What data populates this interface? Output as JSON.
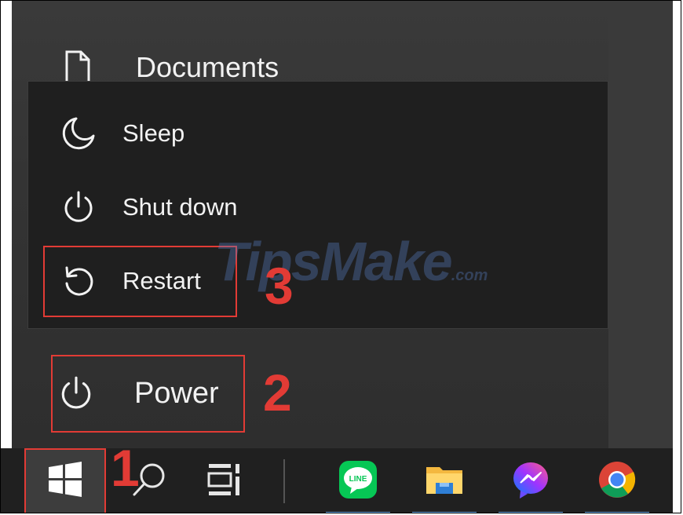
{
  "start_menu": {
    "documents_label": "Documents",
    "power_label": "Power"
  },
  "power_menu": {
    "items": [
      {
        "label": "Sleep",
        "icon": "moon-icon"
      },
      {
        "label": "Shut down",
        "icon": "power-icon"
      },
      {
        "label": "Restart",
        "icon": "restart-icon"
      }
    ]
  },
  "annotations": {
    "step1": "1",
    "step2": "2",
    "step3": "3"
  },
  "watermark": {
    "text": "TipsMake",
    "suffix": ".com"
  },
  "taskbar": {
    "items": [
      {
        "name": "start",
        "icon": "windows-logo-icon"
      },
      {
        "name": "search",
        "icon": "search-icon"
      },
      {
        "name": "task-view",
        "icon": "task-view-icon"
      },
      {
        "name": "line",
        "icon": "line-app-icon",
        "text": "LINE"
      },
      {
        "name": "file-explorer",
        "icon": "folder-icon"
      },
      {
        "name": "messenger",
        "icon": "messenger-icon"
      },
      {
        "name": "chrome",
        "icon": "chrome-icon"
      }
    ]
  },
  "colors": {
    "annotation_red": "#e23b35",
    "menu_bg": "#1f1f1f",
    "panel_bg": "#343434",
    "taskbar_bg": "#202020",
    "accent_blue": "#6aa8e8"
  }
}
